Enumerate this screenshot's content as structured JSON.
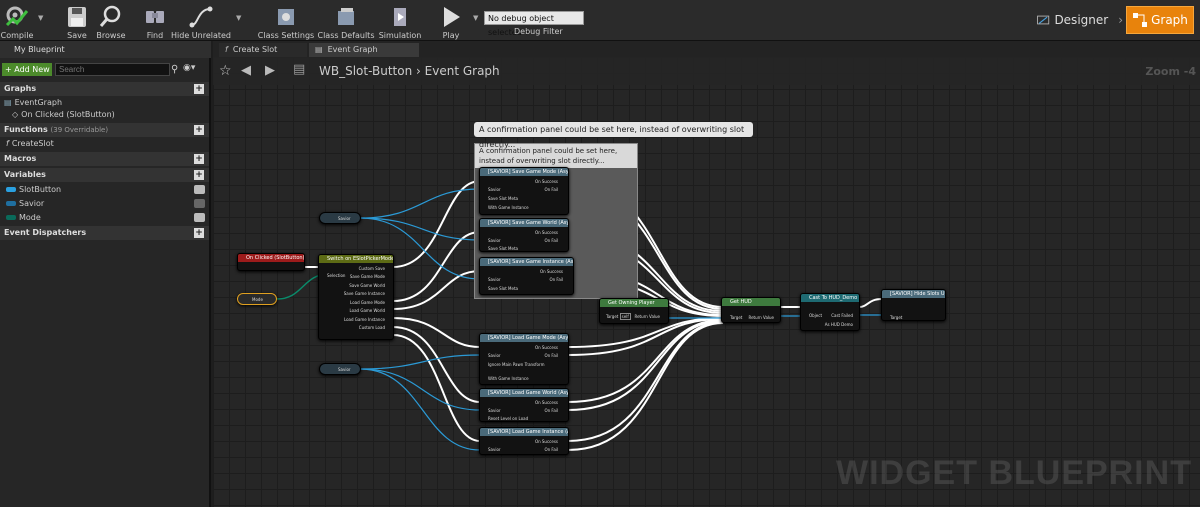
{
  "toolbar": {
    "compile": "Compile",
    "save": "Save",
    "browse": "Browse",
    "find": "Find",
    "hide_unrelated": "Hide Unrelated",
    "class_settings": "Class Settings",
    "class_defaults": "Class Defaults",
    "simulation": "Simulation",
    "play": "Play",
    "debug_value": "No debug object selected",
    "debug_label": "Debug Filter",
    "designer": "Designer",
    "graph": "Graph"
  },
  "left": {
    "tab": "My Blueprint",
    "add_new": "+ Add New",
    "search_placeholder": "Search",
    "graphs": "Graphs",
    "event_graph": "EventGraph",
    "on_clicked": "On Clicked (SlotButton)",
    "functions": "Functions",
    "functions_count": "(39 Overridable)",
    "create_slot": "CreateSlot",
    "macros": "Macros",
    "variables": "Variables",
    "vars": [
      "SlotButton",
      "Savior",
      "Mode"
    ],
    "dispatchers": "Event Dispatchers"
  },
  "tabs": [
    "Create Slot",
    "Event Graph"
  ],
  "breadcrumb": {
    "asset": "WB_Slot-Button",
    "graph": "Event Graph"
  },
  "zoom": "Zoom -4",
  "watermark": "WIDGET BLUEPRINT",
  "comment": {
    "bubble": "A confirmation panel could be set here, instead of overwriting slot directly...",
    "title": "A confirmation panel could be set here, instead of overwriting slot directly..."
  },
  "nodes": {
    "on_clicked": "On Clicked (SlotButton)",
    "switch": "Switch on ESlotPickerMode",
    "switch_pins": [
      "Custom Save",
      "Save Game Mode",
      "Save Game World",
      "Save Game Instance",
      "Load Game Mode",
      "Load Game World",
      "Load Game Instance",
      "Custom Load"
    ],
    "selection": "Selection",
    "mode": "Mode",
    "savior1": "Savior",
    "savior2": "Savior",
    "save_mode": "[SAVIOR] Save Game Mode (Async)",
    "save_world": "[SAVIOR] Save Game World (Async)",
    "save_instance": "[SAVIOR] Save Game Instance (Async)",
    "load_mode": "[SAVIOR] Load Game Mode (Async)",
    "load_world": "[SAVIOR] Load Game World (Async)",
    "load_instance": "[SAVIOR] Load Game Instance (Async)",
    "get_owning": "Get Owning Player",
    "get_hud": "Get HUD",
    "cast": "Cast To HUD_Demo",
    "hide": "[SAVIOR] Hide Slots UI",
    "pins": {
      "on_success": "On Success",
      "on_fail": "On Fail",
      "savior": "Savior",
      "save_slot_meta": "Save Slot Meta",
      "with_game_instance": "With Game Instance",
      "ignore_pawn": "Ignore Main Pawn Transform",
      "reset_level": "Reset Level on Load",
      "target": "Target",
      "self": "self",
      "return_value": "Return Value",
      "object": "Object",
      "cast_failed": "Cast Failed",
      "as_hud": "As HUD Demo"
    }
  }
}
